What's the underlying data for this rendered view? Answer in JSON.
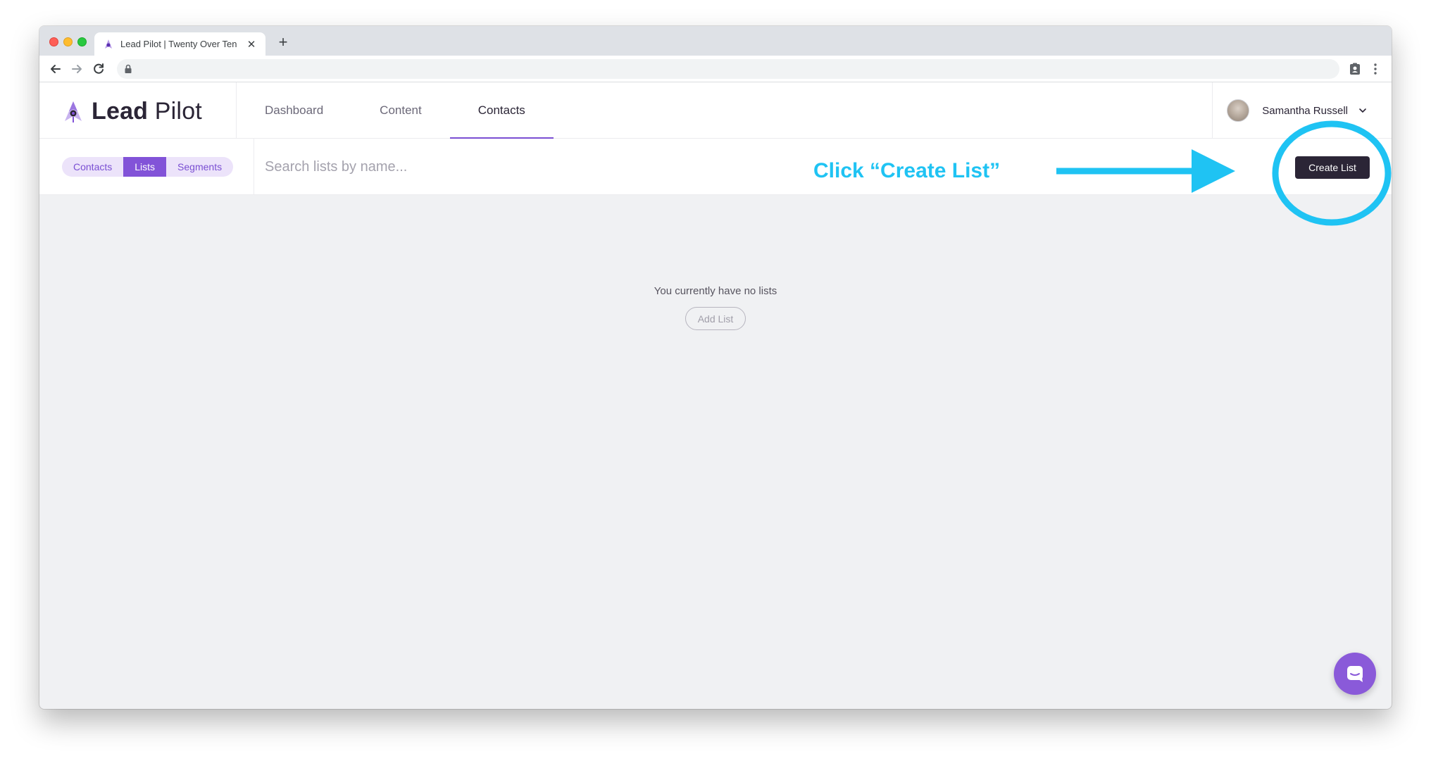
{
  "browser": {
    "tab_title": "Lead Pilot | Twenty Over Ten",
    "new_tab_symbol": "+",
    "close_symbol": "✕"
  },
  "app": {
    "logo": {
      "bold": "Lead",
      "regular": " Pilot"
    },
    "nav": [
      {
        "label": "Dashboard",
        "active": false
      },
      {
        "label": "Content",
        "active": false
      },
      {
        "label": "Contacts",
        "active": true
      }
    ],
    "user": {
      "name": "Samantha Russell"
    }
  },
  "subnav": {
    "segments": [
      {
        "label": "Contacts",
        "active": false
      },
      {
        "label": "Lists",
        "active": true
      },
      {
        "label": "Segments",
        "active": false
      }
    ],
    "search_placeholder": "Search lists by name...",
    "create_button": "Create List"
  },
  "empty_state": {
    "message": "You currently have no lists",
    "button": "Add List"
  },
  "annotation": {
    "text": "Click “Create List”",
    "color": "#1fc3f3"
  },
  "colors": {
    "accent": "#8253d8",
    "dark": "#2b2536"
  }
}
